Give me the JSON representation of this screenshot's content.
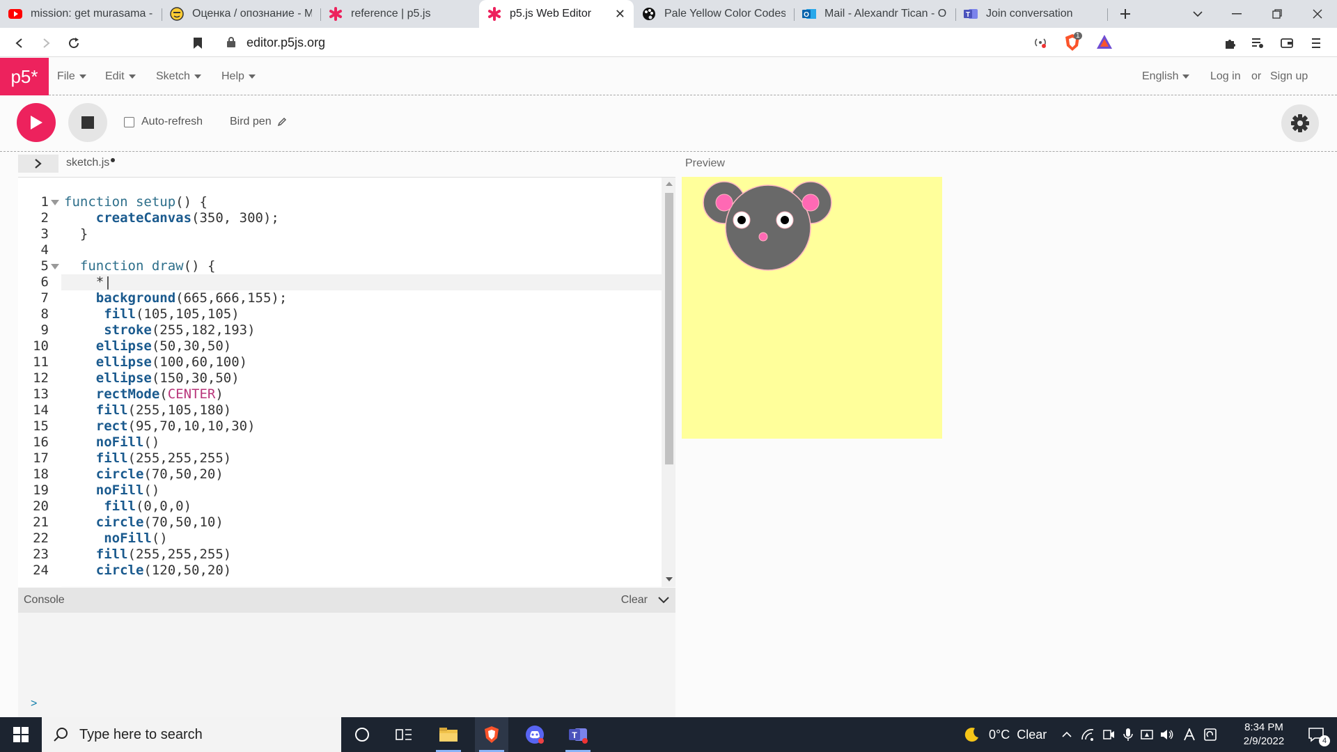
{
  "browser": {
    "tabs": [
      {
        "title": "mission: get murasama - Yo",
        "icon": "youtube-icon"
      },
      {
        "title": "Оценка / опознание - Mo",
        "icon": "emoji-icon"
      },
      {
        "title": "reference | p5.js",
        "icon": "p5-asterisk-icon"
      },
      {
        "title": "p5.js Web Editor",
        "icon": "p5-asterisk-icon",
        "active": true
      },
      {
        "title": "Pale Yellow Color Codes - T",
        "icon": "palette-icon"
      },
      {
        "title": "Mail - Alexandr Tican - Out",
        "icon": "outlook-icon"
      },
      {
        "title": "Join conversation",
        "icon": "teams-icon"
      }
    ],
    "url": "editor.p5js.org",
    "shield_count": "1"
  },
  "app": {
    "logo": "p5*",
    "menu": [
      "File",
      "Edit",
      "Sketch",
      "Help"
    ],
    "language": "English",
    "login": "Log in",
    "or": "or",
    "signup": "Sign up"
  },
  "toolbar": {
    "autorefresh_label": "Auto-refresh",
    "sketch_name": "Bird pen"
  },
  "editor": {
    "filename": "sketch.js",
    "active_line": 6,
    "lines": [
      "function setup() {",
      "    createCanvas(350, 300);",
      "  }",
      "",
      "  function draw() {",
      "    *|",
      "    background(665,666,155);",
      "     fill(105,105,105)",
      "     stroke(255,182,193)",
      "    ellipse(50,30,50)",
      "    ellipse(100,60,100)",
      "    ellipse(150,30,50)",
      "    rectMode(CENTER)",
      "    fill(255,105,180)",
      "    rect(95,70,10,10,30)",
      "    noFill()",
      "    fill(255,255,255)",
      "    circle(70,50,20)",
      "    noFill()",
      "     fill(0,0,0)",
      "    circle(70,50,10)",
      "     noFill()",
      "    fill(255,255,255)",
      "    circle(120,50,20)"
    ]
  },
  "console": {
    "title": "Console",
    "clear": "Clear",
    "prompt": ">"
  },
  "preview": {
    "label": "Preview",
    "background": "#ffff9b",
    "fill": "#696969",
    "stroke": "#ffb6c1",
    "accent": "#ff69b4"
  },
  "taskbar": {
    "search_placeholder": "Type here to search",
    "weather": "0°C  Clear",
    "time": "8:34 PM",
    "date": "2/9/2022",
    "notifications": "4"
  },
  "colors": {
    "p5_pink": "#ed225d",
    "editor_bg": "#ffffff",
    "app_bg": "#fbfbfb"
  }
}
